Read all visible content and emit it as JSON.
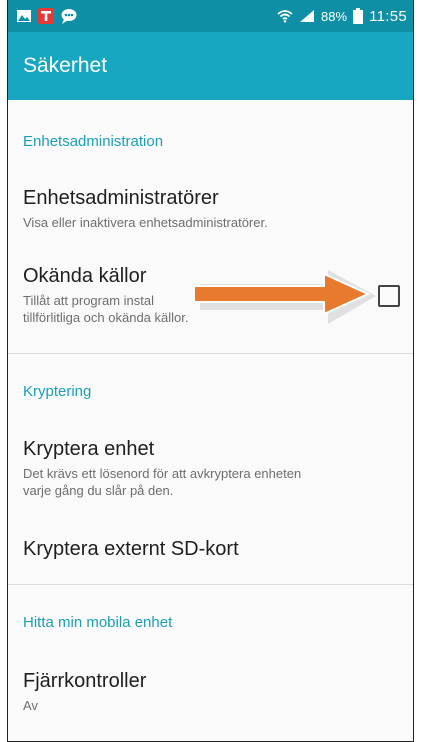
{
  "status_bar": {
    "battery_percent": "88%",
    "time": "11:55",
    "icons": [
      "gallery-icon",
      "t-badge-icon",
      "chat-icon",
      "wifi-icon",
      "signal-icon",
      "battery-icon"
    ]
  },
  "app_bar": {
    "title": "Säkerhet"
  },
  "sections": {
    "device_admin": {
      "header": "Enhetsadministration",
      "admins": {
        "title": "Enhetsadministratörer",
        "summary": "Visa eller inaktivera enhetsadministratörer."
      },
      "unknown_sources": {
        "title": "Okända källor",
        "summary_line1": "Tillåt att program instal",
        "summary_line2": "tillförlitliga och okända källor.",
        "checked": false
      }
    },
    "encryption": {
      "header": "Kryptering",
      "encrypt_device": {
        "title": "Kryptera enhet",
        "summary_line1": "Det krävs ett lösenord för att avkryptera enheten",
        "summary_line2": "varje gång du slår på den."
      },
      "encrypt_sd": {
        "title": "Kryptera externt SD-kort"
      }
    },
    "find_device": {
      "header": "Hitta min mobila enhet",
      "remote_controls": {
        "title": "Fjärrkontroller",
        "summary": "Av"
      }
    }
  },
  "colors": {
    "status_bar": "#0e8fa6",
    "app_bar": "#17a7c0",
    "section_header": "#1a9fb5",
    "annotation_arrow": "#e87a2e"
  }
}
